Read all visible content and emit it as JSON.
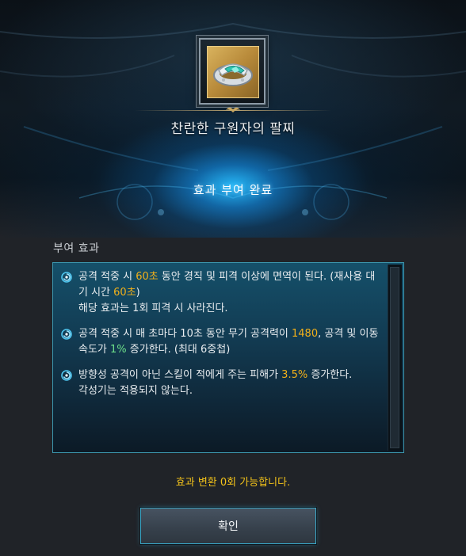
{
  "item": {
    "name": "찬란한 구원자의 팔찌",
    "icon": "bracelet-icon"
  },
  "status": {
    "text": "효과 부여 완료"
  },
  "effects_section": {
    "label": "부여 효과",
    "items": [
      {
        "icon": "swirl-icon",
        "segments": [
          {
            "text": "공격 적중 시 ",
            "hl": ""
          },
          {
            "text": "60초",
            "hl": "gold"
          },
          {
            "text": " 동안 경직 및 피격 이상에 면역이 된다. (재사용 대기 시간 ",
            "hl": ""
          },
          {
            "text": "60초",
            "hl": "gold"
          },
          {
            "text": ")",
            "hl": ""
          },
          {
            "text": "\n해당 효과는 1회 피격 시 사라진다.",
            "hl": ""
          }
        ]
      },
      {
        "icon": "swirl-icon",
        "segments": [
          {
            "text": "공격 적중 시 매 초마다 10초 동안 무기 공격력이 ",
            "hl": ""
          },
          {
            "text": "1480",
            "hl": "gold"
          },
          {
            "text": ", 공격 및 이동 속도가 ",
            "hl": ""
          },
          {
            "text": "1%",
            "hl": "green"
          },
          {
            "text": " 증가한다. (최대 6중첩)",
            "hl": ""
          }
        ]
      },
      {
        "icon": "swirl-icon",
        "segments": [
          {
            "text": "방향성 공격이 아닌 스킬이 적에게 주는 피해가 ",
            "hl": ""
          },
          {
            "text": "3.5%",
            "hl": "gold"
          },
          {
            "text": " 증가한다.",
            "hl": ""
          },
          {
            "text": "\n각성기는 적용되지 않는다.",
            "hl": ""
          }
        ]
      }
    ]
  },
  "convert_note": "효과 변환 0회 가능합니다.",
  "confirm_button": {
    "label": "확인"
  },
  "colors": {
    "highlight_gold": "#f2b01a",
    "highlight_green": "#6ee08a",
    "note_yellow": "#f2c21a",
    "panel_border": "#3c95ac"
  }
}
